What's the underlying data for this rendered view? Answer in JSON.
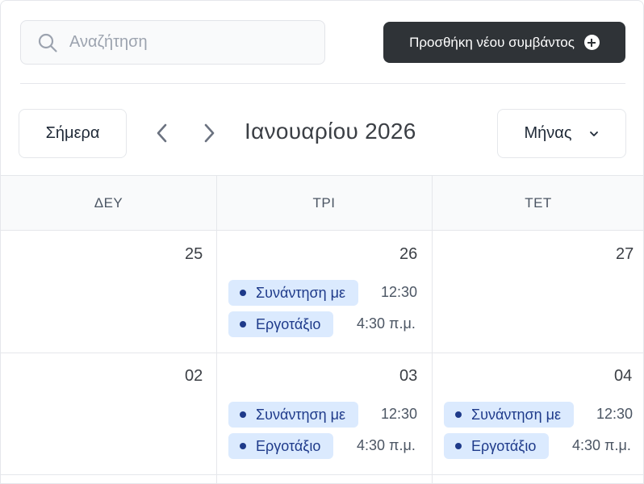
{
  "search": {
    "placeholder": "Αναζήτηση",
    "value": ""
  },
  "add_event_label": "Προσθήκη νέου συμβάντος",
  "toolbar": {
    "today_label": "Σήμερα",
    "month_title": "Ιανουαρίου 2026",
    "view_label": "Μήνας"
  },
  "weekdays": [
    "ΔΕΥ",
    "ΤΡΙ",
    "ΤΕΤ"
  ],
  "weeks": [
    {
      "days": [
        {
          "num": "25",
          "events": []
        },
        {
          "num": "26",
          "events": [
            {
              "title": "Συνάντηση με",
              "time": "12:30"
            },
            {
              "title": "Εργοτάξιο",
              "time": "4:30 π.μ."
            }
          ]
        },
        {
          "num": "27",
          "events": []
        }
      ]
    },
    {
      "days": [
        {
          "num": "02",
          "events": []
        },
        {
          "num": "03",
          "events": [
            {
              "title": "Συνάντηση με",
              "time": "12:30"
            },
            {
              "title": "Εργοτάξιο",
              "time": "4:30 π.μ."
            }
          ]
        },
        {
          "num": "04",
          "events": [
            {
              "title": "Συνάντηση με",
              "time": "12:30"
            },
            {
              "title": "Εργοτάξιο",
              "time": "4:30 π.μ."
            }
          ]
        }
      ]
    }
  ],
  "colors": {
    "primary_button": "#2f3337",
    "event_chip": "#dbeafe",
    "event_text": "#1e3a8a"
  }
}
